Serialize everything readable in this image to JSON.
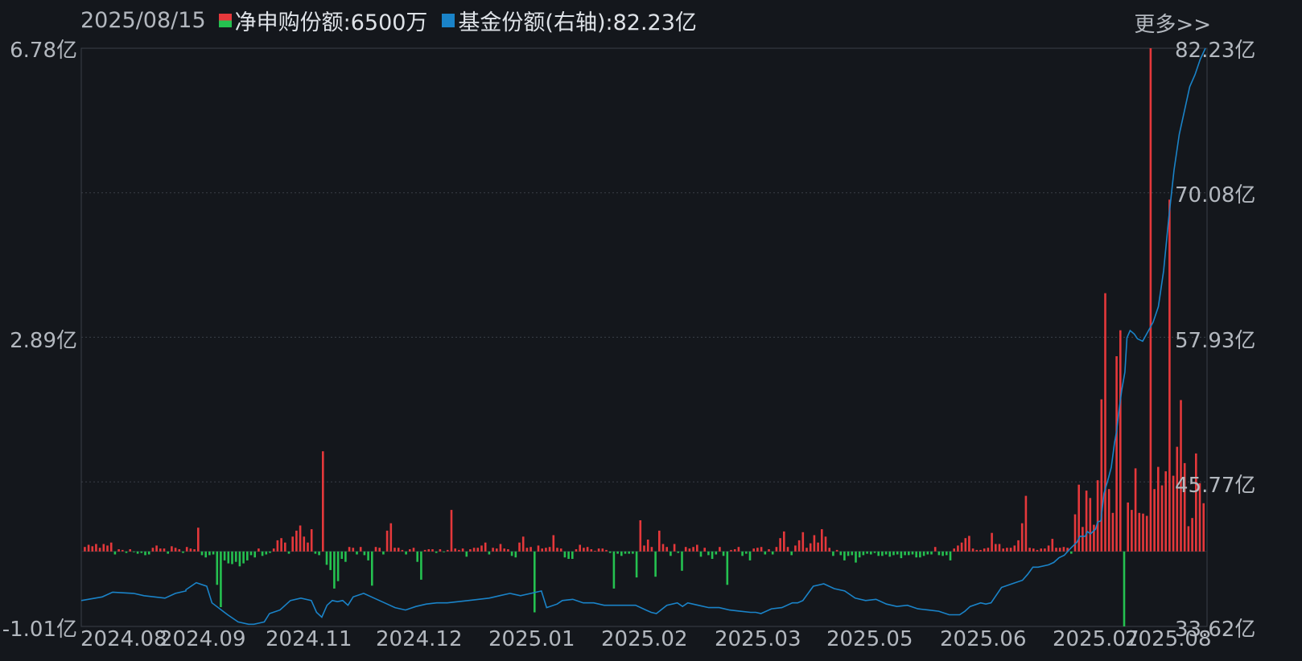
{
  "header": {
    "date": "2025/08/15",
    "more": "更多>>",
    "legend": [
      {
        "label": "净申购份额:6500万",
        "color_up": "#e5383b",
        "color_down": "#25c150"
      },
      {
        "label": "基金份额(右轴):82.23亿",
        "color": "#1a83c8"
      }
    ]
  },
  "axes": {
    "left_ticks": [
      "6.78亿",
      "2.89亿",
      "-1.01亿"
    ],
    "right_ticks": [
      "82.23亿",
      "70.08亿",
      "57.93亿",
      "45.77亿",
      "33.62亿"
    ],
    "x_ticks": [
      "2024.08",
      "2024.09",
      "2024.11",
      "2024.12",
      "2025.01",
      "2025.02",
      "2025.03",
      "2025.05",
      "2025.06",
      "2025.07",
      "2025.08"
    ]
  },
  "chart_data": {
    "type": "bar+line",
    "left_axis": {
      "unit": "亿",
      "range": [
        -1.01,
        6.78
      ],
      "zero": 0
    },
    "right_axis": {
      "unit": "亿",
      "range": [
        33.62,
        82.23
      ]
    },
    "colors": {
      "up": "#e5383b",
      "down": "#25c150",
      "line": "#1a83c8",
      "grid": "#3a3f47"
    },
    "x_range": [
      "2024.08",
      "2025.08.15"
    ],
    "net_subscription": [
      0.06,
      0.09,
      0.07,
      0.1,
      0.05,
      0.1,
      0.08,
      0.12,
      -0.04,
      0.03,
      0.02,
      -0.02,
      0.03,
      -0.01,
      -0.03,
      -0.02,
      -0.05,
      -0.04,
      0.05,
      0.08,
      0.04,
      0.04,
      -0.03,
      0.07,
      0.05,
      0.03,
      -0.02,
      0.06,
      0.04,
      0.03,
      0.32,
      -0.05,
      -0.08,
      -0.05,
      -0.04,
      -0.45,
      -0.75,
      -0.12,
      -0.16,
      -0.17,
      -0.14,
      -0.2,
      -0.16,
      -0.12,
      -0.05,
      -0.08,
      0.04,
      -0.06,
      -0.04,
      -0.02,
      0.04,
      0.15,
      0.18,
      0.12,
      -0.03,
      0.2,
      0.28,
      0.35,
      0.2,
      0.12,
      0.3,
      -0.03,
      -0.05,
      1.35,
      -0.18,
      -0.25,
      -0.5,
      -0.4,
      -0.1,
      -0.14,
      0.06,
      0.05,
      -0.04,
      0.06,
      -0.05,
      -0.12,
      -0.46,
      0.06,
      0.05,
      -0.04,
      0.28,
      0.38,
      0.05,
      0.05,
      0.02,
      -0.04,
      0.03,
      0.05,
      -0.14,
      -0.38,
      0.02,
      0.03,
      0.03,
      -0.02,
      0.03,
      -0.01,
      0.02,
      0.56,
      0.04,
      0.02,
      0.04,
      -0.07,
      0.03,
      0.05,
      0.05,
      0.08,
      0.12,
      -0.04,
      0.05,
      0.04,
      0.1,
      0.04,
      0.03,
      -0.06,
      -0.08,
      0.12,
      0.2,
      0.05,
      0.06,
      -0.82,
      0.08,
      0.04,
      0.05,
      0.06,
      0.22,
      0.05,
      0.04,
      -0.08,
      -0.1,
      -0.1,
      0.03,
      0.09,
      0.05,
      0.06,
      0.03,
      0.01,
      0.04,
      0.04,
      0.02,
      -0.02,
      -0.5,
      -0.03,
      -0.06,
      -0.03,
      -0.03,
      -0.03,
      -0.35,
      0.42,
      0.08,
      0.16,
      0.06,
      -0.34,
      0.28,
      0.1,
      0.06,
      -0.06,
      0.1,
      -0.02,
      -0.26,
      0.06,
      0.04,
      0.06,
      0.09,
      -0.07,
      0.05,
      -0.05,
      -0.1,
      -0.04,
      0.06,
      -0.06,
      -0.45,
      0.02,
      0.03,
      0.06,
      -0.06,
      -0.03,
      -0.12,
      0.04,
      0.05,
      0.06,
      -0.04,
      0.03,
      -0.04,
      0.06,
      0.18,
      0.27,
      0.06,
      -0.05,
      0.08,
      0.15,
      0.26,
      0.05,
      0.11,
      0.22,
      0.12,
      0.3,
      0.2,
      0.05,
      -0.06,
      0.02,
      -0.05,
      -0.12,
      -0.06,
      -0.05,
      -0.15,
      -0.08,
      -0.05,
      -0.03,
      -0.04,
      -0.02,
      -0.06,
      -0.06,
      -0.04,
      -0.07,
      -0.05,
      -0.04,
      -0.09,
      -0.05,
      -0.05,
      -0.04,
      -0.08,
      -0.08,
      -0.06,
      -0.04,
      -0.04,
      0.06,
      -0.05,
      -0.06,
      -0.05,
      -0.12,
      0.04,
      0.08,
      0.12,
      0.18,
      0.21,
      0.04,
      0.02,
      0.02,
      0.04,
      0.05,
      0.25,
      0.1,
      0.1,
      0.04,
      0.05,
      0.05,
      0.08,
      0.15,
      0.38,
      0.75,
      0.05,
      0.04,
      0.02,
      0.04,
      0.04,
      0.08,
      0.17,
      0.05,
      0.05,
      0.06,
      0.05,
      -0.03,
      0.5,
      0.9,
      0.33,
      0.82,
      0.72,
      0.36,
      0.96,
      2.05,
      3.48,
      0.84,
      0.52,
      2.63,
      2.98,
      -1.01,
      0.66,
      0.56,
      1.12,
      0.52,
      0.51,
      0.48,
      6.78,
      0.84,
      1.14,
      0.89,
      1.08,
      4.74,
      1.02,
      1.41,
      2.04,
      1.19,
      0.34,
      0.45,
      1.32,
      0.92,
      0.65
    ],
    "fund_share": [
      [
        0,
        35.8
      ],
      [
        0.02,
        36.1
      ],
      [
        0.03,
        36.5
      ],
      [
        0.05,
        36.4
      ],
      [
        0.06,
        36.2
      ],
      [
        0.08,
        36.0
      ],
      [
        0.09,
        36.4
      ],
      [
        0.1,
        36.6
      ],
      [
        0.1,
        36.7
      ],
      [
        0.11,
        37.3
      ],
      [
        0.12,
        37.0
      ],
      [
        0.125,
        35.6
      ],
      [
        0.14,
        34.6
      ],
      [
        0.15,
        34.0
      ],
      [
        0.16,
        33.8
      ],
      [
        0.165,
        33.8
      ],
      [
        0.17,
        33.9
      ],
      [
        0.175,
        34.0
      ],
      [
        0.18,
        34.7
      ],
      [
        0.19,
        35.0
      ],
      [
        0.2,
        35.8
      ],
      [
        0.21,
        36.0
      ],
      [
        0.22,
        35.8
      ],
      [
        0.225,
        34.8
      ],
      [
        0.23,
        34.4
      ],
      [
        0.235,
        35.4
      ],
      [
        0.24,
        35.8
      ],
      [
        0.245,
        35.7
      ],
      [
        0.25,
        35.8
      ],
      [
        0.255,
        35.4
      ],
      [
        0.26,
        36.1
      ],
      [
        0.27,
        36.4
      ],
      [
        0.28,
        36.0
      ],
      [
        0.29,
        35.6
      ],
      [
        0.3,
        35.2
      ],
      [
        0.31,
        35.0
      ],
      [
        0.32,
        35.3
      ],
      [
        0.33,
        35.5
      ],
      [
        0.34,
        35.6
      ],
      [
        0.35,
        35.6
      ],
      [
        0.37,
        35.8
      ],
      [
        0.38,
        35.9
      ],
      [
        0.39,
        36.0
      ],
      [
        0.4,
        36.2
      ],
      [
        0.41,
        36.4
      ],
      [
        0.42,
        36.2
      ],
      [
        0.43,
        36.4
      ],
      [
        0.44,
        36.6
      ],
      [
        0.445,
        35.2
      ],
      [
        0.455,
        35.5
      ],
      [
        0.46,
        35.8
      ],
      [
        0.47,
        35.9
      ],
      [
        0.48,
        35.6
      ],
      [
        0.49,
        35.6
      ],
      [
        0.5,
        35.4
      ],
      [
        0.51,
        35.4
      ],
      [
        0.53,
        35.4
      ],
      [
        0.54,
        35.0
      ],
      [
        0.545,
        34.8
      ],
      [
        0.55,
        34.7
      ],
      [
        0.56,
        35.4
      ],
      [
        0.57,
        35.6
      ],
      [
        0.575,
        35.3
      ],
      [
        0.58,
        35.6
      ],
      [
        0.59,
        35.4
      ],
      [
        0.6,
        35.2
      ],
      [
        0.61,
        35.2
      ],
      [
        0.62,
        35.0
      ],
      [
        0.63,
        34.9
      ],
      [
        0.64,
        34.8
      ],
      [
        0.645,
        34.8
      ],
      [
        0.65,
        34.7
      ],
      [
        0.66,
        35.1
      ],
      [
        0.67,
        35.2
      ],
      [
        0.68,
        35.6
      ],
      [
        0.685,
        35.6
      ],
      [
        0.69,
        35.8
      ],
      [
        0.7,
        37.0
      ],
      [
        0.71,
        37.2
      ],
      [
        0.72,
        36.8
      ],
      [
        0.73,
        36.6
      ],
      [
        0.74,
        36.0
      ],
      [
        0.75,
        35.8
      ],
      [
        0.76,
        35.9
      ],
      [
        0.77,
        35.5
      ],
      [
        0.78,
        35.3
      ],
      [
        0.79,
        35.4
      ],
      [
        0.8,
        35.1
      ],
      [
        0.81,
        35.0
      ],
      [
        0.82,
        34.9
      ],
      [
        0.83,
        34.6
      ],
      [
        0.84,
        34.6
      ],
      [
        0.845,
        34.9
      ],
      [
        0.85,
        35.3
      ],
      [
        0.86,
        35.6
      ],
      [
        0.865,
        35.5
      ],
      [
        0.87,
        35.6
      ],
      [
        0.88,
        36.9
      ],
      [
        0.89,
        37.2
      ],
      [
        0.9,
        37.5
      ],
      [
        0.905,
        38.0
      ],
      [
        0.91,
        38.6
      ],
      [
        0.915,
        38.6
      ],
      [
        0.925,
        38.8
      ],
      [
        0.93,
        39.0
      ],
      [
        0.935,
        39.4
      ],
      [
        0.94,
        39.6
      ],
      [
        0.945,
        40.1
      ],
      [
        0.952,
        40.7
      ],
      [
        0.955,
        41.2
      ],
      [
        0.96,
        41.2
      ],
      [
        0.962,
        41.6
      ],
      [
        0.965,
        41.4
      ],
      [
        0.97,
        41.8
      ],
      [
        0.972,
        42.4
      ],
      [
        0.975,
        42.5
      ],
      [
        0.978,
        44.8
      ],
      [
        0.98,
        45.4
      ],
      [
        0.982,
        46.0
      ],
      [
        0.985,
        47.0
      ],
      [
        0.988,
        49.0
      ],
      [
        0.99,
        50.0
      ],
      [
        0.992,
        51.5
      ],
      [
        0.995,
        53.5
      ],
      [
        0.998,
        55.0
      ],
      [
        1.0,
        57.9
      ],
      [
        1.003,
        58.5
      ],
      [
        1.007,
        58.2
      ],
      [
        1.01,
        57.8
      ],
      [
        1.015,
        57.6
      ],
      [
        1.02,
        58.4
      ],
      [
        1.025,
        59.2
      ],
      [
        1.03,
        60.5
      ],
      [
        1.035,
        63.5
      ],
      [
        1.04,
        68.0
      ],
      [
        1.045,
        72.0
      ],
      [
        1.05,
        75.0
      ],
      [
        1.055,
        77.0
      ],
      [
        1.06,
        79.0
      ],
      [
        1.065,
        80.0
      ],
      [
        1.07,
        81.3
      ],
      [
        1.075,
        82.23
      ]
    ]
  }
}
